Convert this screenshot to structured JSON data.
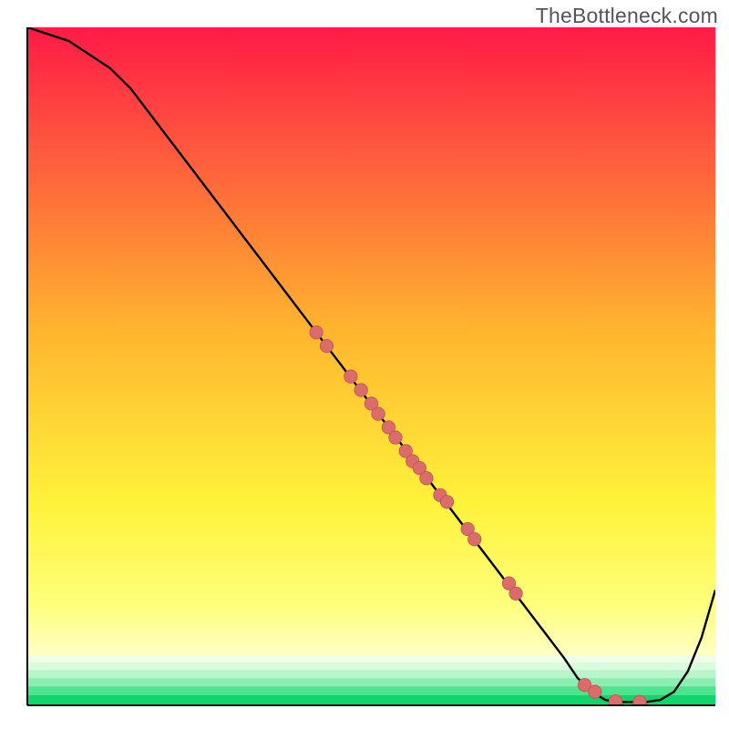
{
  "watermark": "TheBottleneck.com",
  "colors": {
    "gradient_top": "#ff1a47",
    "gradient_upper_mid": "#ffb62e",
    "gradient_mid": "#fff23a",
    "gradient_yellow_pale": "#ffff7a",
    "gradient_pale": "#ffffc8",
    "gradient_green": "#18e07a",
    "curve": "#000000",
    "point_fill": "#db6c6c",
    "point_stroke": "#c25353"
  },
  "chart_data": {
    "type": "line",
    "title": "",
    "xlabel": "",
    "ylabel": "",
    "xlim": [
      0,
      100
    ],
    "ylim": [
      0,
      100
    ],
    "grid": false,
    "legend": false,
    "series": [
      {
        "name": "bottleneck-curve",
        "x": [
          0,
          3,
          6,
          9,
          12,
          15,
          18,
          21,
          24,
          27,
          30,
          33,
          36,
          39,
          42,
          45,
          48,
          51,
          54,
          57,
          60,
          63,
          66,
          69,
          72,
          75,
          78,
          80,
          82,
          84,
          86,
          88,
          90,
          92,
          94,
          96,
          98,
          100
        ],
        "y": [
          100,
          99,
          98,
          96,
          94,
          91,
          87,
          83,
          79,
          75,
          71,
          67,
          63,
          59,
          55,
          51,
          47,
          43,
          39,
          35,
          31,
          27,
          23,
          19,
          15,
          11,
          7,
          4,
          2,
          0.8,
          0.5,
          0.5,
          0.5,
          0.8,
          2,
          5,
          10,
          17
        ]
      }
    ],
    "scatter_points": {
      "name": "highlighted-points-on-curve",
      "points": [
        {
          "x": 42,
          "y": 55
        },
        {
          "x": 43.5,
          "y": 53
        },
        {
          "x": 47,
          "y": 48.5
        },
        {
          "x": 48.5,
          "y": 46.5
        },
        {
          "x": 50,
          "y": 44.5
        },
        {
          "x": 51,
          "y": 43
        },
        {
          "x": 52.5,
          "y": 41
        },
        {
          "x": 53.5,
          "y": 39.5
        },
        {
          "x": 55,
          "y": 37.5
        },
        {
          "x": 56,
          "y": 36
        },
        {
          "x": 57,
          "y": 35
        },
        {
          "x": 58,
          "y": 33.5
        },
        {
          "x": 60,
          "y": 31
        },
        {
          "x": 61,
          "y": 30
        },
        {
          "x": 64,
          "y": 26
        },
        {
          "x": 65,
          "y": 24.5
        },
        {
          "x": 70,
          "y": 18
        },
        {
          "x": 71,
          "y": 16.5
        },
        {
          "x": 81,
          "y": 3
        },
        {
          "x": 82.5,
          "y": 2
        },
        {
          "x": 85.5,
          "y": 0.6
        },
        {
          "x": 89,
          "y": 0.5
        }
      ]
    }
  }
}
